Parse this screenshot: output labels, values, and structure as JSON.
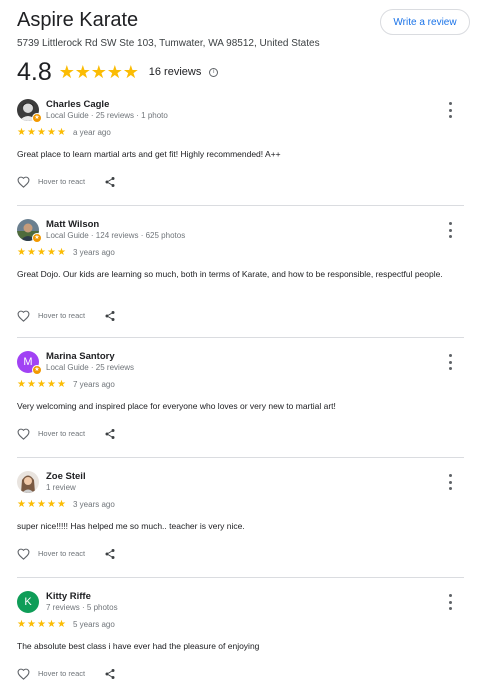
{
  "place": {
    "name": "Aspire Karate",
    "address": "5739 Littlerock Rd SW Ste 103, Tumwater, WA 98512, United States",
    "rating": "4.8",
    "rating_value": 4.8,
    "review_count_label": "16 reviews",
    "info_icon": "info-icon",
    "write_review_label": "Write a review"
  },
  "colors": {
    "star": "#fbbc04",
    "link": "#1a73e8",
    "divider": "#dadce0",
    "guide_badge": "#f29900"
  },
  "react_label": "Hover to react",
  "reviews": [
    {
      "name": "Charles Cagle",
      "meta": "Local Guide · 25 reviews · 1 photo",
      "stars": 5,
      "time": "a year ago",
      "text": "Great place to learn martial arts and get fit! Highly recommended! A++",
      "avatar": "photo",
      "local_guide": true
    },
    {
      "name": "Matt Wilson",
      "meta": "Local Guide · 124 reviews · 625 photos",
      "stars": 5,
      "time": "3 years ago",
      "text": "Great Dojo. Our kids are learning so much, both in terms of Karate, and how to be responsible, respectful people.",
      "avatar": "photo",
      "local_guide": true
    },
    {
      "name": "Marina Santory",
      "meta": "Local Guide · 25 reviews",
      "stars": 5,
      "time": "7 years ago",
      "text": "Very welcoming and inspired place for everyone who loves or very new to martial art!",
      "avatar": "letter",
      "avatar_letter": "M",
      "avatar_color": "#a142f4",
      "local_guide": true
    },
    {
      "name": "Zoe Steil",
      "meta": "1 review",
      "stars": 5,
      "time": "3 years ago",
      "text": "super nice!!!!! Has helped me so much.. teacher is very nice.",
      "avatar": "photo",
      "local_guide": false
    },
    {
      "name": "Kitty Riffe",
      "meta": "7 reviews · 5 photos",
      "stars": 5,
      "time": "5 years ago",
      "text": "The absolute best class i have ever had the pleasure of enjoying",
      "avatar": "letter",
      "avatar_letter": "K",
      "avatar_color": "#0f9d58",
      "local_guide": false
    }
  ]
}
